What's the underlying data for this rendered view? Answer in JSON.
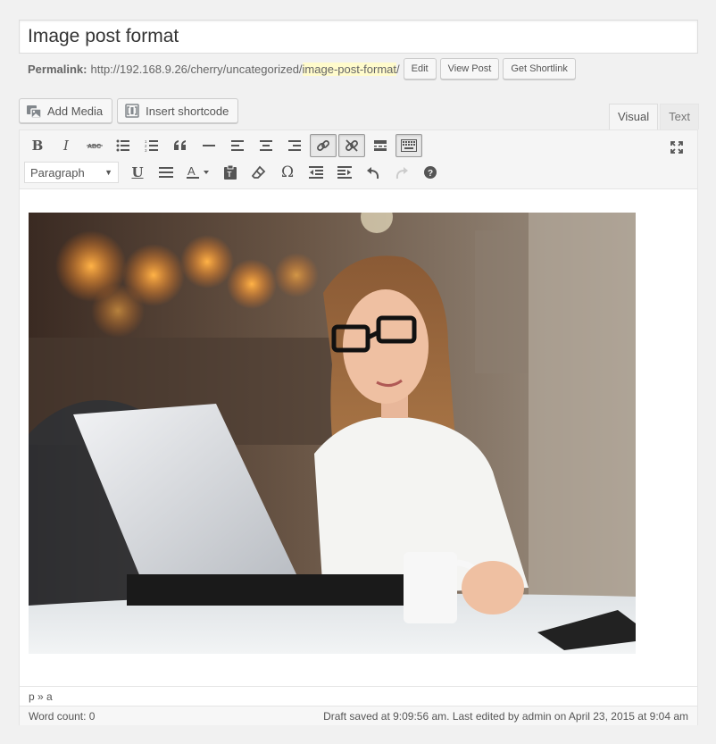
{
  "post": {
    "title": "Image post format"
  },
  "permalink": {
    "label": "Permalink:",
    "base_url": "http://192.168.9.26/cherry/uncategorized/",
    "slug": "image-post-format",
    "trailing": "/",
    "edit_label": "Edit",
    "view_label": "View Post",
    "shortlink_label": "Get Shortlink"
  },
  "media_buttons": {
    "add_media": "Add Media",
    "insert_shortcode": "Insert shortcode"
  },
  "tabs": {
    "visual": "Visual",
    "text": "Text"
  },
  "toolbar": {
    "row1": [
      "bold",
      "italic",
      "strikethrough",
      "bulleted-list",
      "numbered-list",
      "blockquote",
      "horizontal-line",
      "align-left",
      "align-center",
      "align-right",
      "insert-link",
      "remove-link",
      "read-more",
      "toolbar-toggle",
      "fullscreen"
    ],
    "row2": [
      "format-select",
      "underline",
      "justify",
      "text-color",
      "paste-as-text",
      "clear-formatting",
      "special-character",
      "decrease-indent",
      "increase-indent",
      "undo",
      "redo",
      "help"
    ],
    "format_value": "Paragraph"
  },
  "editor": {
    "path": "p » a",
    "word_count": "Word count: 0",
    "status": "Draft saved at 9:09:56 am. Last edited by admin on April 23, 2015 at 9:04 am"
  }
}
